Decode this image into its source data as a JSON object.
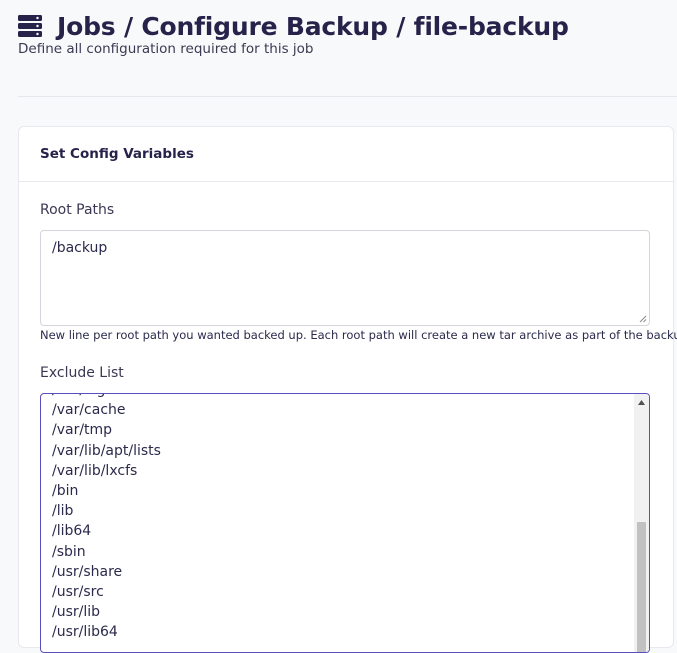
{
  "header": {
    "title": "Jobs / Configure Backup / file-backup",
    "subtitle": "Define all configuration required for this job",
    "icon": "server-icon"
  },
  "card": {
    "title": "Set Config Variables",
    "root_paths": {
      "label": "Root Paths",
      "value": "/backup",
      "help": "New line per root path you wanted backed up. Each root path will create a new tar archive as part of the backup job"
    },
    "exclude_list": {
      "label": "Exclude List",
      "lines": [
        "/var/cache",
        "/var/tmp",
        "/var/lib/apt/lists",
        "/var/lib/lxcfs",
        "/bin",
        "/lib",
        "/lib64",
        "/sbin",
        "/usr/share",
        "/usr/src",
        "/usr/lib"
      ]
    }
  },
  "colors": {
    "accent": "#5b4fc0",
    "title": "#26224a",
    "background": "#f8f9fb"
  }
}
